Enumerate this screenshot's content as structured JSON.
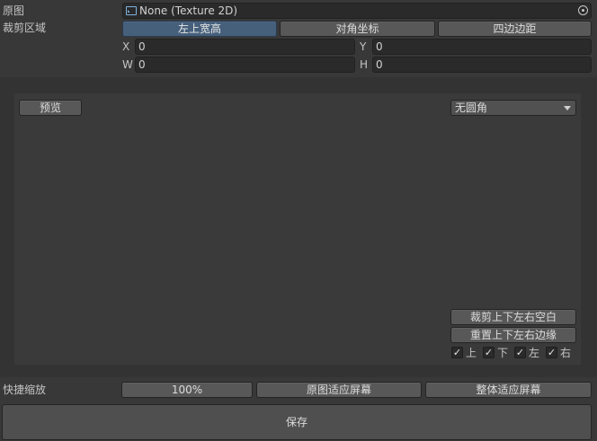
{
  "source_image": {
    "label": "原图",
    "value": "None (Texture 2D)",
    "icon": "texture-icon",
    "picker_icon": "object-picker-icon"
  },
  "crop_area": {
    "label": "裁剪区域",
    "modes": [
      "左上宽高",
      "对角坐标",
      "四边边距"
    ],
    "active_mode": 0,
    "x": {
      "label": "X",
      "value": "0"
    },
    "y": {
      "label": "Y",
      "value": "0"
    },
    "w": {
      "label": "W",
      "value": "0"
    },
    "h": {
      "label": "H",
      "value": "0"
    }
  },
  "preview": {
    "preview_button": "预览",
    "corner_dropdown": {
      "selected": "无圆角"
    },
    "trim_button": "裁剪上下左右空白",
    "reset_button": "重置上下左右边缘",
    "edge_toggles": [
      {
        "label": "上",
        "checked": true
      },
      {
        "label": "下",
        "checked": true
      },
      {
        "label": "左",
        "checked": true
      },
      {
        "label": "右",
        "checked": true
      }
    ]
  },
  "quick_zoom": {
    "label": "快捷缩放",
    "buttons": [
      "100%",
      "原图适应屏幕",
      "整体适应屏幕"
    ]
  },
  "save_button": "保存",
  "colors": {
    "background": "#383838",
    "active_button": "#46607c",
    "field": "#2a2a2a"
  }
}
